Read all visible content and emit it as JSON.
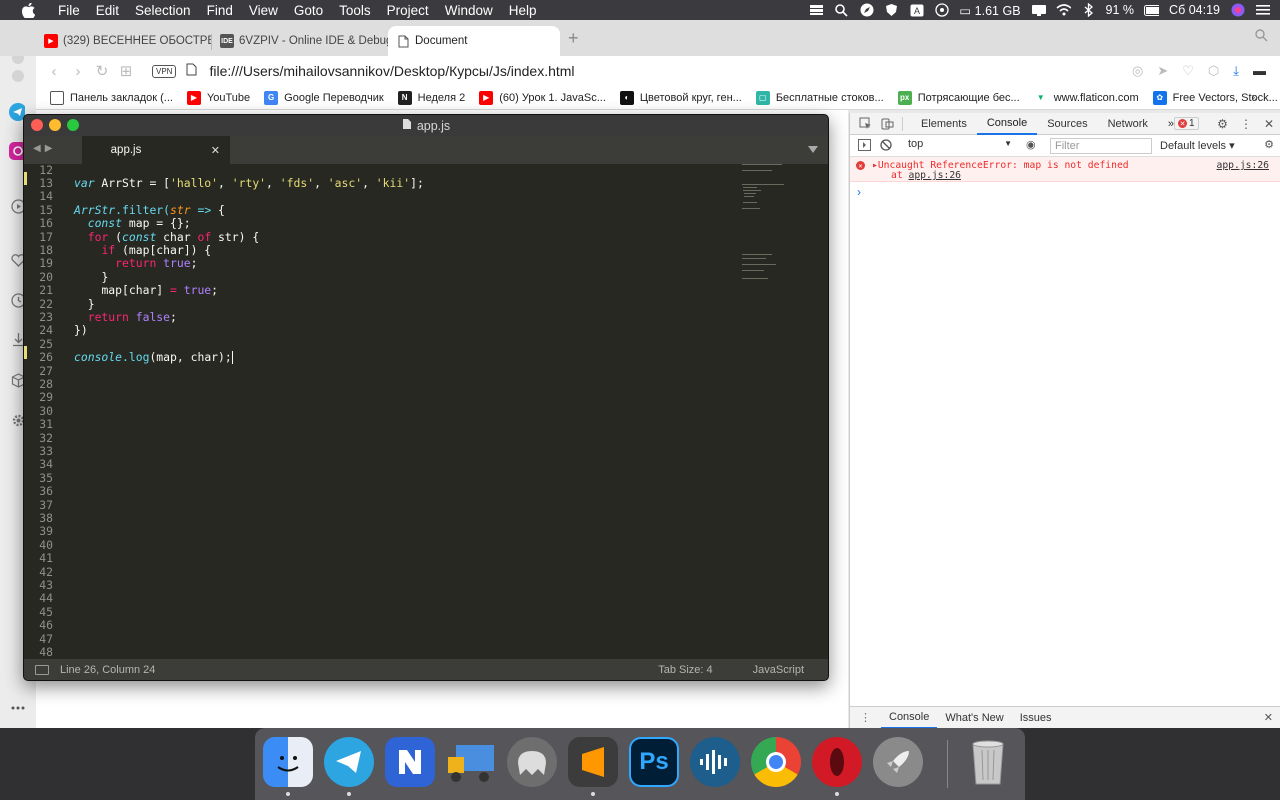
{
  "menubar": {
    "app_name": "Sublime Text",
    "items": [
      "File",
      "Edit",
      "Selection",
      "Find",
      "View",
      "Goto",
      "Tools",
      "Project",
      "Window",
      "Help"
    ],
    "status": {
      "memory": "1.61 GB",
      "battery": "91 %",
      "clock": "Сб 04:19"
    }
  },
  "browser": {
    "tabs": [
      {
        "title": "(329) ВЕСЕННЕЕ ОБОСТРЕНИ",
        "favicon": "youtube-icon"
      },
      {
        "title": "6VZPIV - Online IDE & Debugg",
        "favicon": "ide-icon"
      },
      {
        "title": "Document",
        "favicon": "document-icon"
      }
    ],
    "vpn_label": "VPN",
    "url": "file:///Users/mihailovsannikov/Desktop/Курсы/Js/index.html",
    "bookmarks": [
      "Панель закладок (...",
      "YouTube",
      "Google Переводчик",
      "Неделя 2",
      "(60) Урок 1. JavaSc...",
      "Цветовой круг, ген...",
      "Бесплатные стоков...",
      "Потрясающие бес...",
      "www.flaticon.com",
      "Free Vectors, Stock..."
    ],
    "bookmarks_more": "»"
  },
  "editor": {
    "window_title": "app.js",
    "tab_name": "app.js",
    "line_numbers": [
      "12",
      "13",
      "14",
      "15",
      "16",
      "17",
      "18",
      "19",
      "20",
      "21",
      "22",
      "23",
      "24",
      "25",
      "26",
      "27",
      "28",
      "29",
      "30",
      "31",
      "32",
      "33",
      "34",
      "35",
      "36",
      "37",
      "38",
      "39",
      "40",
      "41",
      "42",
      "43",
      "44",
      "45",
      "46",
      "47",
      "48"
    ],
    "code": {
      "var": "var",
      "arr_decl": " ArrStr = [",
      "s1": "'hallo'",
      "s2": "'rty'",
      "s3": "'fds'",
      "s4": "'asc'",
      "s5": "'kii'",
      "sep": ", ",
      "arr_end": "];",
      "arr_obj": "ArrStr",
      "dot_filter": ".filter(",
      "param": "str",
      "arrow": " => ",
      "open_brace": "{",
      "const": "const",
      "map_decl": " map = {};",
      "for": "for",
      "for_open": " (",
      "char_decl": " char ",
      "of": "of",
      "for_close": " str) {",
      "if": "if",
      "if_cond": " (map[char]) {",
      "return": "return",
      "true": "true",
      "semi": ";",
      "close_brace": "}",
      "map_assign": "map[char] ",
      "eq": "=",
      "false": "false",
      "close_call": "})",
      "console": "console",
      "dot_log": ".log",
      "log_args": "(map, char);"
    },
    "status_left": "Line 26, Column 24",
    "tab_size": "Tab Size: 4",
    "syntax": "JavaScript"
  },
  "devtools": {
    "tabs": [
      "Elements",
      "Console",
      "Sources",
      "Network"
    ],
    "active_tab": "Console",
    "more": "»",
    "error_count": "1",
    "context": "top",
    "filter_placeholder": "Filter",
    "levels": "Default levels ▾",
    "error_line1": "Uncaught ReferenceError: map is not defined",
    "error_at": "at ",
    "error_link": "app.js:26",
    "error_source": "app.js:26",
    "prompt": "›",
    "drawer_tabs": [
      "Console",
      "What's New",
      "Issues"
    ]
  },
  "dock": {
    "apps": [
      "finder-icon",
      "telegram-icon",
      "notion-icon",
      "transmit-icon",
      "sequel-pro-icon",
      "sublime-text-icon",
      "photoshop-icon",
      "audio-app-icon",
      "chrome-icon",
      "opera-icon",
      "rocket-icon",
      "trash-icon"
    ],
    "ps_label": "Ps"
  },
  "colors": {
    "editor_bg": "#272822",
    "keyword": "#f92672",
    "string": "#e6db74",
    "constant": "#ae81ff",
    "function": "#66d9ef",
    "param": "#fd971f",
    "error_red": "#ef2b2b",
    "devtools_accent": "#1a73e8"
  }
}
